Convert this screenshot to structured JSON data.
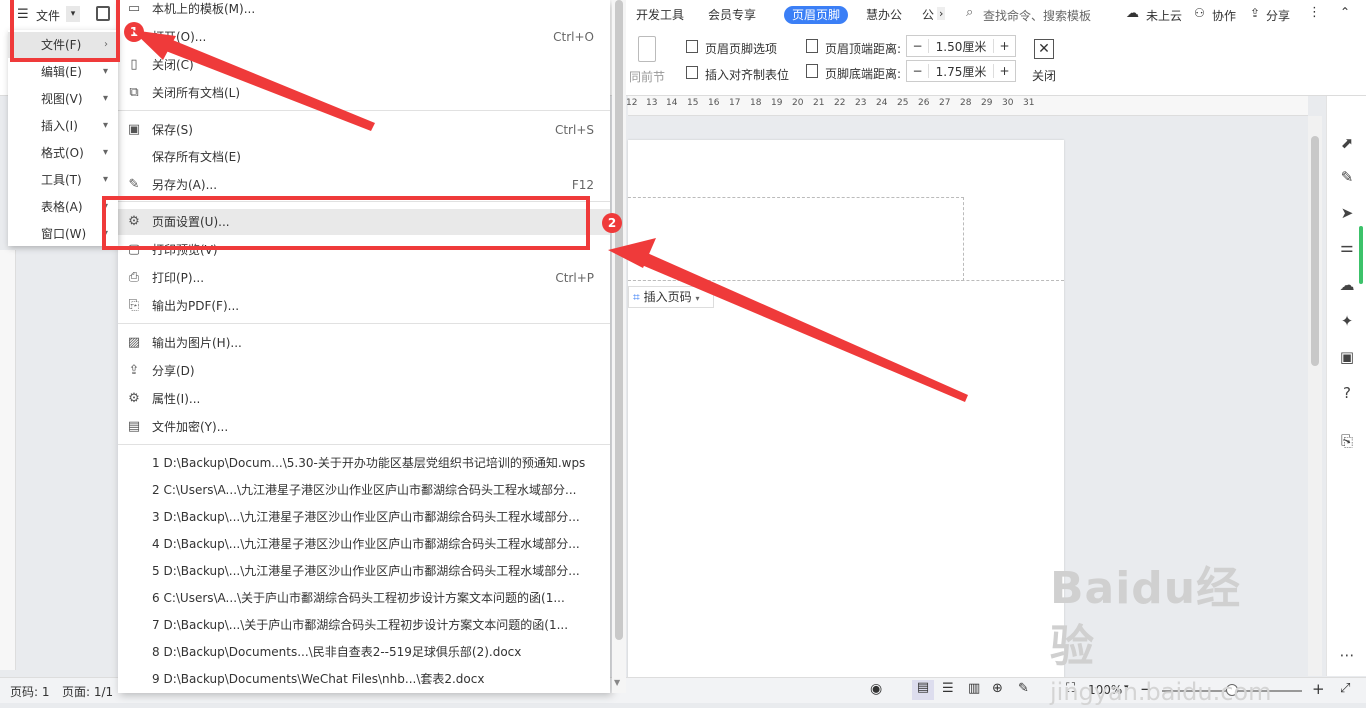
{
  "titlebar": {
    "menu_label": "文件",
    "tabs": [
      "开发工具",
      "会员专享",
      "页眉页脚",
      "慧办公",
      "公"
    ],
    "active_tab": "页眉页脚",
    "search_placeholder": "查找命令、搜索模板",
    "cloud": "未上云",
    "collab": "协作",
    "share": "分享"
  },
  "ribbon": {
    "prev_section": "同前节",
    "hf_options": "页眉页脚选项",
    "insert_tab": "插入对齐制表位",
    "header_top_label": "页眉顶端距离:",
    "header_top_value": "1.50厘米",
    "footer_bottom_label": "页脚底端距离:",
    "footer_bottom_value": "1.75厘米",
    "close": "关闭"
  },
  "ruler_ticks": [
    "12",
    "13",
    "14",
    "15",
    "16",
    "17",
    "18",
    "19",
    "20",
    "21",
    "22",
    "23",
    "24",
    "25",
    "26",
    "27",
    "28",
    "29",
    "30",
    "31"
  ],
  "left_menu": [
    {
      "label": "文件(F)",
      "selected": true
    },
    {
      "label": "编辑(E)"
    },
    {
      "label": "视图(V)"
    },
    {
      "label": "插入(I)"
    },
    {
      "label": "格式(O)"
    },
    {
      "label": "工具(T)"
    },
    {
      "label": "表格(A)"
    },
    {
      "label": "窗口(W)"
    }
  ],
  "file_menu": {
    "items": [
      {
        "label": "本机上的模板(M)...",
        "shortcut": "",
        "icon": "template-icon"
      },
      {
        "label": "打开(O)...",
        "shortcut": "Ctrl+O",
        "icon": "open-icon"
      },
      {
        "label": "关闭(C)",
        "shortcut": "",
        "icon": "close-doc-icon"
      },
      {
        "label": "关闭所有文档(L)",
        "shortcut": "",
        "icon": "close-all-icon"
      },
      {
        "label": "保存(S)",
        "shortcut": "Ctrl+S",
        "icon": "save-icon"
      },
      {
        "label": "保存所有文档(E)",
        "shortcut": "",
        "icon": ""
      },
      {
        "label": "另存为(A)...",
        "shortcut": "F12",
        "icon": "save-as-icon"
      },
      {
        "label": "页面设置(U)...",
        "shortcut": "",
        "icon": "page-setup-icon"
      },
      {
        "label": "打印预览(V)",
        "shortcut": "",
        "icon": "print-preview-icon"
      },
      {
        "label": "打印(P)...",
        "shortcut": "Ctrl+P",
        "icon": "print-icon"
      },
      {
        "label": "输出为PDF(F)...",
        "shortcut": "",
        "icon": "pdf-icon"
      },
      {
        "label": "输出为图片(H)...",
        "shortcut": "",
        "icon": "image-icon"
      },
      {
        "label": "分享(D)",
        "shortcut": "",
        "icon": "share-icon"
      },
      {
        "label": "属性(I)...",
        "shortcut": "",
        "icon": "properties-icon"
      },
      {
        "label": "文件加密(Y)...",
        "shortcut": "",
        "icon": "encrypt-icon"
      }
    ],
    "recent": [
      "1 D:\\Backup\\Docum...\\5.30-关于开办功能区基层党组织书记培训的预通知.wps",
      "2 C:\\Users\\A...\\九江港星子港区沙山作业区庐山市鄱湖综合码头工程水域部分...",
      "3 D:\\Backup\\...\\九江港星子港区沙山作业区庐山市鄱湖综合码头工程水域部分...",
      "4 D:\\Backup\\...\\九江港星子港区沙山作业区庐山市鄱湖综合码头工程水域部分...",
      "5 D:\\Backup\\...\\九江港星子港区沙山作业区庐山市鄱湖综合码头工程水域部分...",
      "6 C:\\Users\\A...\\关于庐山市鄱湖综合码头工程初步设计方案文本问题的函(1...",
      "7 D:\\Backup\\...\\关于庐山市鄱湖综合码头工程初步设计方案文本问题的函(1...",
      "8 D:\\Backup\\Documents...\\民非自查表2--519足球俱乐部(2).docx",
      "9 D:\\Backup\\Documents\\WeChat Files\\nhb...\\套表2.docx"
    ]
  },
  "document": {
    "insert_page_num": "插入页码"
  },
  "status": {
    "pages_label": "页码: 1",
    "page_label": "页面: 1/1",
    "zoom": "100%"
  },
  "badges": {
    "one": "1",
    "two": "2"
  },
  "watermark": {
    "brand": "Baidu经验",
    "url": "jingyan.baidu.com"
  },
  "colors": {
    "accent": "#3b7ff6",
    "annotation": "#ef3a3a"
  }
}
